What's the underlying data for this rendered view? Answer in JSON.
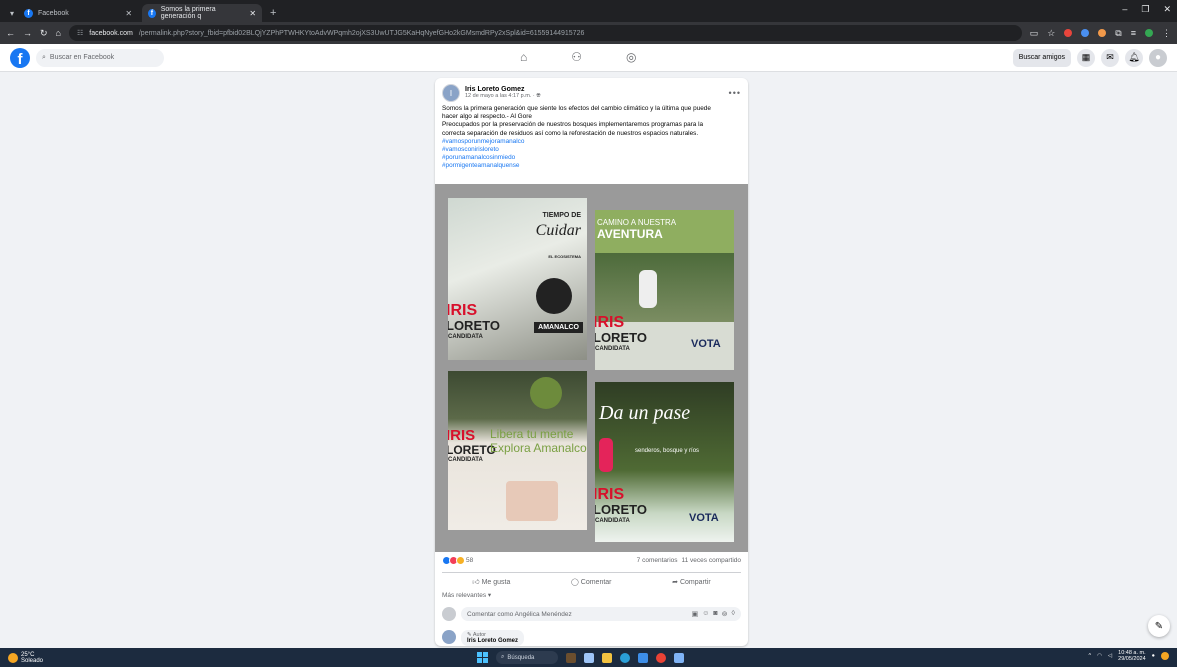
{
  "browser": {
    "tabs": [
      {
        "title": "Facebook",
        "active": false
      },
      {
        "title": "Somos la primera generación q",
        "active": true
      }
    ],
    "url_domain": "facebook.com",
    "url_path": "/permalink.php?story_fbid=pfbid02BLQjYZPhPTWHKYtoAdvWPqmh2ojXS3UwUTJG5KaHqNyefGHo2kGMsmdRPy2xSpl&id=61559144915726"
  },
  "facebook": {
    "search_placeholder": "Buscar en Facebook",
    "find_friends": "Buscar amigos"
  },
  "post": {
    "author": "Iris Loreto Gomez",
    "date": "12 de mayo a las 4:17 p.m. · ",
    "text_lines": [
      "Somos la primera generación que siente los efectos del cambio climático y la última que puede",
      "hacer algo al respecto.- Al Gore",
      "Preocupados por la preservación de nuestros bosques implementaremos programas para la",
      "correcta separación de residuos así como la reforestación de nuestros espacios naturales."
    ],
    "hashtags": [
      "#vamosporunmejoramanalco",
      "#vamosconirisloreto",
      "#porunamanalcosinmiedo",
      "#pormigenteamanalquense"
    ],
    "image_texts": {
      "t1_a": "TIEMPO DE",
      "t1_b": "Cuidar",
      "t1_c": "EL ECOSISTEMA",
      "t1_d": "AMANALCO",
      "t2_a": "CAMINO A NUESTRA",
      "t2_b": "AVENTURA",
      "t3_a": "Libera tu mente",
      "t3_b": "Explora Amanalco",
      "t4_a": "Da un pase",
      "t4_b": "senderos, bosque y ríos",
      "iris": "IRIS",
      "loreto": "LORETO",
      "candidata": "CANDIDATA",
      "vota": "VOTA",
      "vota_date": "2 de Junio"
    },
    "reaction_count": "58",
    "comments_count": "7 comentarios",
    "shares_count": "11 veces compartido",
    "actions": {
      "like": "Me gusta",
      "comment": "Comentar",
      "share": "Compartir"
    },
    "sort_label": "Más relevantes",
    "comment_placeholder": "Comentar como Angélica Menéndez",
    "first_comment": {
      "badge": "Autor",
      "name": "Iris Loreto Gomez"
    }
  },
  "taskbar": {
    "temp": "25°C",
    "weather": "Soleado",
    "search": "Búsqueda",
    "time": "10:48 a. m.",
    "date": "29/05/2024"
  }
}
